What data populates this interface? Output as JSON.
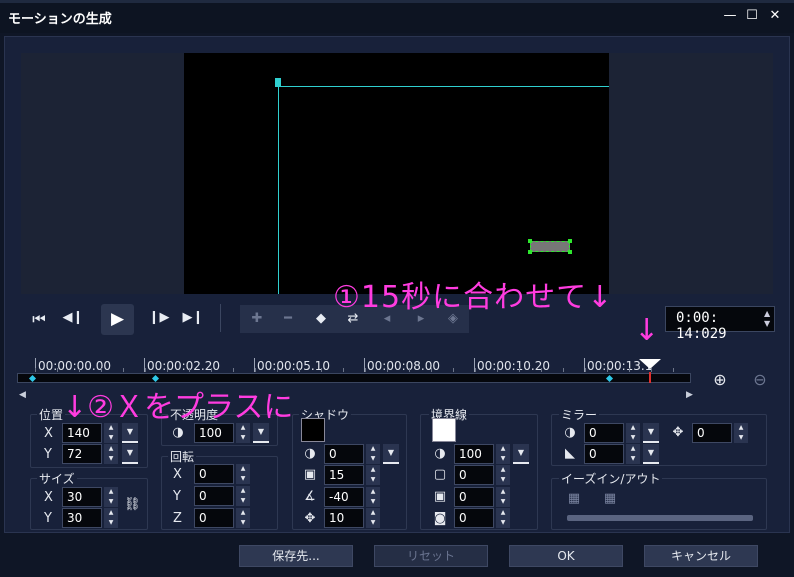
{
  "window": {
    "title": "モーションの生成",
    "minimize_icon": "minimize-icon",
    "maximize_icon": "maximize-icon",
    "close_icon": "close-icon"
  },
  "transport": {
    "go_start": "⏮",
    "step_back": "◀❙",
    "play": "▶",
    "step_forward": "❙▶",
    "go_end": "▶❙",
    "timecode": "0:00: 14:029"
  },
  "keyframe_tools": [
    "add-keyframe-icon",
    "remove-keyframe-icon",
    "reverse-path-icon",
    "swap-keyframes-icon",
    "prev-keyframe-icon",
    "next-keyframe-icon",
    "fade-keyframe-icon"
  ],
  "ruler": {
    "labels": [
      "00:00:00.00",
      "00:00:02.20",
      "00:00:05.10",
      "00:00:08.00",
      "00:00:10.20",
      "00:00:13.1"
    ]
  },
  "zoom": {
    "in_icon": "zoom-in-icon",
    "out_icon": "zoom-out-icon"
  },
  "annotations": {
    "step1": "①15秒に合わせて↓",
    "step1_arrow": "↓",
    "step2": "↓②Ｘをプラスに"
  },
  "position": {
    "label": "位置",
    "x_label": "X",
    "x_value": "140",
    "y_label": "Y",
    "y_value": "72"
  },
  "size": {
    "label": "サイズ",
    "x_label": "X",
    "x_value": "30",
    "y_label": "Y",
    "y_value": "30"
  },
  "opacity": {
    "label": "不透明度",
    "value": "100"
  },
  "rotation": {
    "label": "回転",
    "x_label": "X",
    "x_value": "0",
    "y_label": "Y",
    "y_value": "0",
    "z_label": "Z",
    "z_value": "0"
  },
  "shadow": {
    "label": "シャドウ",
    "color": "#000000",
    "opacity": "0",
    "blur": "15",
    "angle": "-40",
    "distance": "10"
  },
  "border": {
    "label": "境界線",
    "color": "#ffffff",
    "opacity": "100",
    "width": "0",
    "blur": "0",
    "fill": "0"
  },
  "mirror": {
    "label": "ミラー",
    "opacity": "0",
    "offset": "0",
    "distance": "0"
  },
  "ease": {
    "label": "イーズイン/アウト"
  },
  "buttons": {
    "save_to": "保存先...",
    "reset": "リセット",
    "ok": "OK",
    "cancel": "キャンセル"
  }
}
